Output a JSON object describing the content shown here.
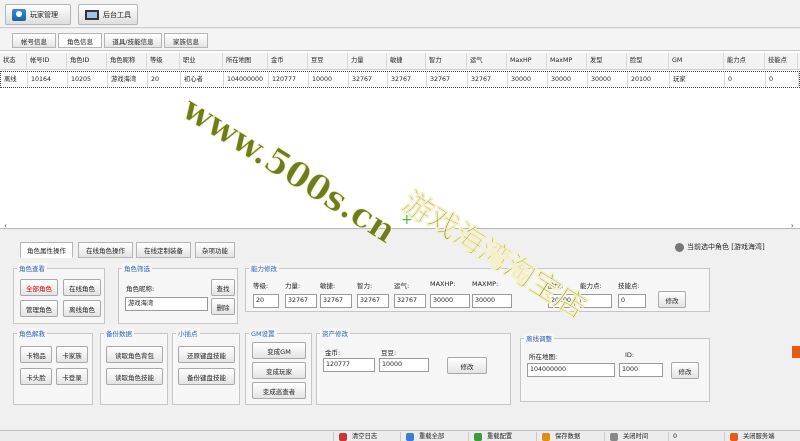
{
  "top_tabs": [
    {
      "label": "玩家管理"
    },
    {
      "label": "后台工具"
    }
  ],
  "sub_tabs": [
    {
      "label": "帐号信息"
    },
    {
      "label": "角色信息"
    },
    {
      "label": "道具/技能信息"
    },
    {
      "label": "家族信息"
    }
  ],
  "grid": {
    "headers": [
      "状态",
      "帐号ID",
      "角色ID",
      "角色昵称",
      "等级",
      "职业",
      "所在地图",
      "金币",
      "豆豆",
      "力量",
      "敏捷",
      "智力",
      "运气",
      "MaxHP",
      "MaxMP",
      "发型",
      "脸型",
      "GM",
      "能力点",
      "技能点"
    ],
    "row": [
      "离线",
      "10164",
      "10205",
      "游戏海湾",
      "20",
      "初心者",
      "104000000",
      "120777",
      "10000",
      "32767",
      "32767",
      "32767",
      "32767",
      "30000",
      "30000",
      "30000",
      "20100",
      "玩家",
      "0",
      "0"
    ]
  },
  "bottom_tabs": [
    {
      "label": "角色属性操作"
    },
    {
      "label": "在线角色操作"
    },
    {
      "label": "在线定制装备"
    },
    {
      "label": "杂项功能"
    }
  ],
  "current_selection": "当前选中角色 [游戏海湾]",
  "role_view": {
    "title": "角色查看",
    "all": "全部角色",
    "online": "在线角色",
    "manage": "管理角色",
    "offline": "离线角色"
  },
  "role_filter": {
    "title": "角色筛选",
    "nick_label": "角色昵称:",
    "nick_value": "游戏海湾",
    "find": "查找",
    "delete": "删除"
  },
  "ability": {
    "title": "能力修改",
    "fields": [
      {
        "label": "等级:",
        "value": "20"
      },
      {
        "label": "力量:",
        "value": "32767"
      },
      {
        "label": "敏捷:",
        "value": "32767"
      },
      {
        "label": "智力:",
        "value": "32767"
      },
      {
        "label": "运气:",
        "value": "32767"
      },
      {
        "label": "MAXHP:",
        "value": "30000"
      },
      {
        "label": "MAXMP:",
        "value": "30000"
      },
      {
        "label": "脸型:",
        "value": "20100"
      },
      {
        "label": "能力点:",
        "value": "0"
      },
      {
        "label": "技能点:",
        "value": "0"
      }
    ],
    "modify": "修改"
  },
  "role_unlock": {
    "title": "角色解救",
    "kawupin": "卡物品",
    "kajiaohua": "卡家族",
    "katoulian": "卡头脸",
    "kadenglu": "卡登录"
  },
  "backup": {
    "title": "备份数据",
    "read_bag": "读取角色背包",
    "read_skill": "读取角色技能"
  },
  "gadgets": {
    "title": "小插点",
    "restore": "还原键盘技能",
    "backup": "备份键盘技能"
  },
  "gm": {
    "title": "GM设置",
    "become_gm": "变成GM",
    "become_player": "变成玩家",
    "become_observer": "变成巡查者"
  },
  "assets": {
    "title": "资产修改",
    "gold_label": "金币:",
    "gold_value": "120777",
    "bean_label": "豆豆:",
    "bean_value": "10000",
    "modify": "修改"
  },
  "offline": {
    "title": "离线调整",
    "map_label": "所在地图:",
    "map_value": "104000000",
    "id_label": "ID:",
    "id_value": "1000",
    "modify": "修改"
  },
  "footer": [
    {
      "label": "清空日志"
    },
    {
      "label": "重载全部"
    },
    {
      "label": "重载配置"
    },
    {
      "label": "保存数据"
    },
    {
      "label": "关闭时间"
    },
    {
      "label": "0"
    },
    {
      "label": "关闭服务端"
    }
  ],
  "watermark": {
    "line1": "www.500s.cn",
    "line2": "游戏海湾淘宝店"
  },
  "colors": {
    "accent_blue": "#2d63b8",
    "red_text": "#cc0000",
    "watermark_green": "#6f7c1c"
  }
}
